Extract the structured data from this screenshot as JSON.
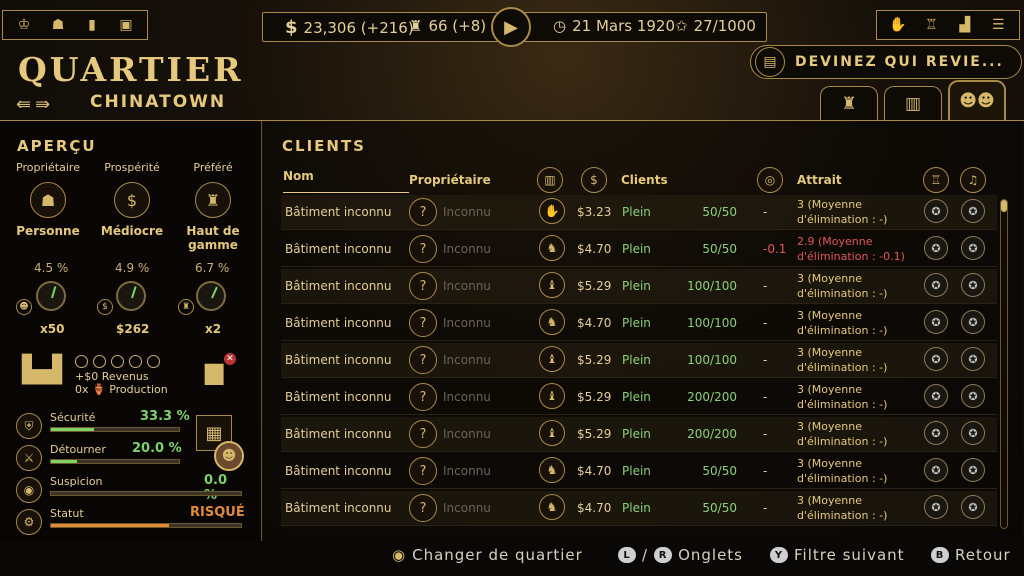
{
  "topbar": {
    "money": "23,306 (+216)",
    "cakes": "66 (+8)",
    "date": "21 Mars 1920",
    "stars": "27/1000"
  },
  "title": {
    "main": "QUARTIER",
    "district": "CHINATOWN"
  },
  "guess_button": "DEVINEZ QUI REVIE...",
  "overview": {
    "title": "APERÇU",
    "cols": [
      {
        "label": "Propriétaire",
        "value": "Personne",
        "icon": "owner-icon"
      },
      {
        "label": "Prospérité",
        "value": "Médiocre",
        "icon": "dollar-icon"
      },
      {
        "label": "Préféré",
        "value": "Haut de gamme",
        "icon": "cake-icon"
      }
    ],
    "gauges": [
      {
        "pct": "4.5 %",
        "value": "x50",
        "level": 0.045
      },
      {
        "pct": "4.9 %",
        "value": "$262",
        "level": 0.049
      },
      {
        "pct": "6.7 %",
        "value": "x2",
        "level": 0.067
      }
    ],
    "revenue_line1": "+$0 Revenus",
    "revenue_line2": "0x 🏺 Production",
    "bars": [
      {
        "label": "Sécurité",
        "value": "33.3 %",
        "fill": 0.333,
        "color": "#7fd16a"
      },
      {
        "label": "Détourner",
        "value": "20.0 %",
        "fill": 0.2,
        "color": "#7fd16a"
      },
      {
        "label": "Suspicion",
        "value": "0.0 %",
        "fill": 0.0,
        "color": "#7fd16a"
      },
      {
        "label": "Statut",
        "value": "RISQUÉ",
        "fill": 0.62,
        "color": "#e08a3a"
      }
    ]
  },
  "clients": {
    "title": "CLIENTS",
    "headers": {
      "name": "Nom",
      "owner": "Propriétaire",
      "clients": "Clients",
      "attract": "Attrait"
    },
    "rows": [
      {
        "name": "Bâtiment inconnu",
        "owner": "Inconnu",
        "price": "$3.23",
        "status": "Plein",
        "count": "50/50",
        "delta": "-",
        "attract": "3 (Moyenne d'élimination : -)",
        "neg": false
      },
      {
        "name": "Bâtiment inconnu",
        "owner": "Inconnu",
        "price": "$4.70",
        "status": "Plein",
        "count": "50/50",
        "delta": "-0.1",
        "attract": "2.9 (Moyenne d'élimination : -0.1)",
        "neg": true
      },
      {
        "name": "Bâtiment inconnu",
        "owner": "Inconnu",
        "price": "$5.29",
        "status": "Plein",
        "count": "100/100",
        "delta": "-",
        "attract": "3 (Moyenne d'élimination : -)",
        "neg": false
      },
      {
        "name": "Bâtiment inconnu",
        "owner": "Inconnu",
        "price": "$4.70",
        "status": "Plein",
        "count": "100/100",
        "delta": "-",
        "attract": "3 (Moyenne d'élimination : -)",
        "neg": false
      },
      {
        "name": "Bâtiment inconnu",
        "owner": "Inconnu",
        "price": "$5.29",
        "status": "Plein",
        "count": "100/100",
        "delta": "-",
        "attract": "3 (Moyenne d'élimination : -)",
        "neg": false
      },
      {
        "name": "Bâtiment inconnu",
        "owner": "Inconnu",
        "price": "$5.29",
        "status": "Plein",
        "count": "200/200",
        "delta": "-",
        "attract": "3 (Moyenne d'élimination : -)",
        "neg": false
      },
      {
        "name": "Bâtiment inconnu",
        "owner": "Inconnu",
        "price": "$5.29",
        "status": "Plein",
        "count": "200/200",
        "delta": "-",
        "attract": "3 (Moyenne d'élimination : -)",
        "neg": false
      },
      {
        "name": "Bâtiment inconnu",
        "owner": "Inconnu",
        "price": "$4.70",
        "status": "Plein",
        "count": "50/50",
        "delta": "-",
        "attract": "3 (Moyenne d'élimination : -)",
        "neg": false
      },
      {
        "name": "Bâtiment inconnu",
        "owner": "Inconnu",
        "price": "$4.70",
        "status": "Plein",
        "count": "50/50",
        "delta": "-",
        "attract": "3 (Moyenne d'élimination : -)",
        "neg": false
      }
    ]
  },
  "hints": {
    "change": "Changer de quartier",
    "l_btn": "L",
    "slash": "/",
    "r_btn": "R",
    "tabs": "Onglets",
    "y_btn": "Y",
    "filter": "Filtre suivant",
    "b_btn": "B",
    "back": "Retour"
  }
}
